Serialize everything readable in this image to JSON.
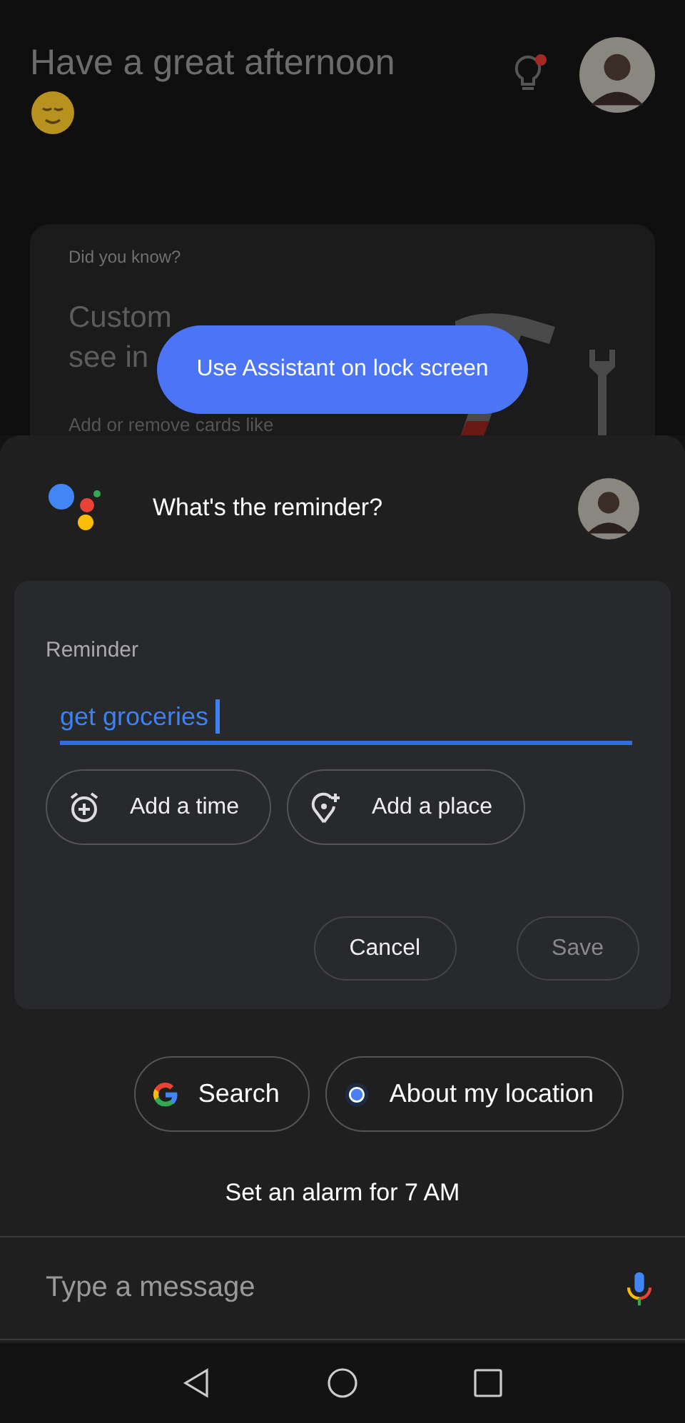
{
  "background": {
    "greeting": "Have a great afternoon",
    "tip_dot": true,
    "card": {
      "label": "Did you know?",
      "title_lines": [
        "Custom",
        "see in"
      ],
      "body": "Add or remove cards like"
    }
  },
  "tooltip": "Use Assistant on lock screen",
  "sheet": {
    "prompt": "What's the reminder?",
    "reminder": {
      "label": "Reminder",
      "value": "get groceries",
      "focused": true,
      "chips": [
        {
          "kind": "time",
          "label": "Add a time"
        },
        {
          "kind": "place",
          "label": "Add a place"
        }
      ],
      "actions": [
        {
          "label": "Cancel",
          "disabled": false
        },
        {
          "label": "Save",
          "disabled": true
        }
      ]
    },
    "suggestions": [
      {
        "kind": "google",
        "label": "Search"
      },
      {
        "kind": "location",
        "label": "About my location"
      }
    ],
    "suggestion_text": "Set an alarm for 7 AM",
    "input": {
      "placeholder": "Type a message"
    }
  },
  "nav": [
    {
      "kind": "back"
    },
    {
      "kind": "home"
    },
    {
      "kind": "recents"
    }
  ]
}
